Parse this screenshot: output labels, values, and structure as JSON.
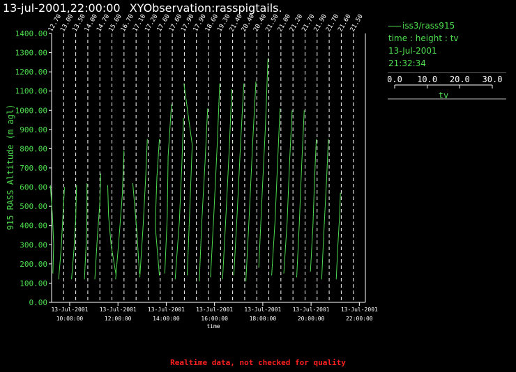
{
  "header": {
    "timestamp": "13-jul-2001,22:00:00",
    "title": "XYObservation:rasspigtails."
  },
  "legend": {
    "series_name": "iss3/rass915",
    "line2": "time : height : tv",
    "line3": "13-Jul-2001",
    "line4": "21:32:34",
    "scale_ticks": [
      "0.0",
      "10.0",
      "20.0",
      "30.0"
    ],
    "scale_label": "tv"
  },
  "footer": {
    "note": "Realtime data, not checked for quality"
  },
  "colors": {
    "trace": "#4ddc4d",
    "axis": "#ffffff",
    "title_text": "#ffffff",
    "warning": "#ff2020",
    "background": "#000000"
  },
  "chart_data": {
    "type": "line",
    "title": "XYObservation:rasspigtails.",
    "xlabel": "time",
    "ylabel": "915 RASS Altitude (m agl)",
    "ylim": [
      0,
      1400
    ],
    "xlim_hours": [
      9.25,
      22.25
    ],
    "y_ticks": [
      "0.00",
      "100.00",
      "200.00",
      "300.00",
      "400.00",
      "500.00",
      "600.00",
      "700.00",
      "800.00",
      "900.00",
      "1000.00",
      "1100.00",
      "1200.00",
      "1300.00",
      "1400.00"
    ],
    "x_ticks": [
      {
        "hour": 10,
        "date": "13-Jul-2001",
        "time": "10:00:00"
      },
      {
        "hour": 12,
        "date": "13-Jul-2001",
        "time": "12:00:00"
      },
      {
        "hour": 14,
        "date": "13-Jul-2001",
        "time": "14:00:00"
      },
      {
        "hour": 16,
        "date": "13-Jul-2001",
        "time": "16:00:00"
      },
      {
        "hour": 18,
        "date": "13-Jul-2001",
        "time": "18:00:00"
      },
      {
        "hour": 20,
        "date": "13-Jul-2001",
        "time": "20:00:00"
      },
      {
        "hour": 22,
        "date": "13-Jul-2001",
        "time": "22:00:00"
      }
    ],
    "profiles": [
      {
        "hour": 9.25,
        "label": "12.70",
        "top": 610,
        "heights": [
          150,
          300,
          450,
          610
        ],
        "offsets": [
          1.5,
          2.5,
          1.0,
          -1.5
        ]
      },
      {
        "hour": 9.75,
        "label": "13.00",
        "top": 600,
        "heights": [
          120,
          280,
          440,
          600
        ],
        "offsets": [
          -6,
          -3,
          -1,
          1
        ]
      },
      {
        "hour": 10.25,
        "label": "13.50",
        "top": 610,
        "heights": [
          120,
          280,
          440,
          610
        ],
        "offsets": [
          -5,
          -2,
          0,
          1
        ]
      },
      {
        "hour": 10.75,
        "label": "14.00",
        "top": 620,
        "heights": [
          120,
          300,
          460,
          620
        ],
        "offsets": [
          -4,
          -2,
          -1,
          -1
        ]
      },
      {
        "hour": 11.25,
        "label": "14.70",
        "top": 670,
        "heights": [
          120,
          340,
          520,
          670
        ],
        "offsets": [
          -6,
          -3,
          0,
          1
        ]
      },
      {
        "hour": 11.75,
        "label": "15.60",
        "top": 610,
        "heights": [
          140,
          300,
          450,
          610
        ],
        "offsets": [
          5,
          -1,
          -4,
          -5
        ]
      },
      {
        "hour": 12.25,
        "label": "16.70",
        "top": 790,
        "heights": [
          120,
          330,
          560,
          790
        ],
        "offsets": [
          -10,
          -6,
          -2,
          0
        ]
      },
      {
        "hour": 12.75,
        "label": "17.10",
        "top": 620,
        "heights": [
          150,
          360,
          520,
          620
        ],
        "offsets": [
          4,
          1,
          -2,
          -4
        ]
      },
      {
        "hour": 13.25,
        "label": "17.20",
        "top": 850,
        "heights": [
          130,
          400,
          650,
          850
        ],
        "offsets": [
          -10,
          -6,
          -3,
          -1
        ]
      },
      {
        "hour": 13.75,
        "label": "17.60",
        "top": 850,
        "heights": [
          140,
          400,
          650,
          850
        ],
        "offsets": [
          -1,
          -6,
          -4,
          -1
        ]
      },
      {
        "hour": 14.25,
        "label": "17.60",
        "top": 1030,
        "heights": [
          150,
          450,
          760,
          1030
        ],
        "offsets": [
          -9,
          -6,
          -5,
          -1
        ]
      },
      {
        "hour": 14.75,
        "label": "17.90",
        "top": 960,
        "heights": [
          120,
          420,
          720,
          960
        ],
        "offsets": [
          -11,
          -6,
          -3,
          -1
        ]
      },
      {
        "hour": 15.25,
        "label": "17.90",
        "top": 1140,
        "heights": [
          140,
          480,
          820,
          1140
        ],
        "offsets": [
          -11,
          -8,
          -5,
          -15
        ]
      },
      {
        "hour": 15.75,
        "label": "18.60",
        "top": 1010,
        "heights": [
          110,
          420,
          740,
          1010
        ],
        "offsets": [
          -11,
          -8,
          -4,
          -1
        ]
      },
      {
        "hour": 16.25,
        "label": "19.30",
        "top": 1140,
        "heights": [
          130,
          460,
          820,
          1140
        ],
        "offsets": [
          -12,
          -8,
          -4,
          -1
        ]
      },
      {
        "hour": 16.75,
        "label": "21.40",
        "top": 1110,
        "heights": [
          120,
          450,
          800,
          1110
        ],
        "offsets": [
          -12,
          -8,
          -4,
          -1
        ]
      },
      {
        "hour": 17.25,
        "label": "20.40",
        "top": 1140,
        "heights": [
          140,
          460,
          820,
          1140
        ],
        "offsets": [
          -13,
          -9,
          -5,
          -1
        ]
      },
      {
        "hour": 17.75,
        "label": "20.40",
        "top": 1150,
        "heights": [
          110,
          450,
          820,
          1150
        ],
        "offsets": [
          -13,
          -9,
          -5,
          -1
        ]
      },
      {
        "hour": 18.25,
        "label": "21.50",
        "top": 1270,
        "heights": [
          180,
          560,
          920,
          1270
        ],
        "offsets": [
          -12,
          -8,
          -4,
          -1
        ]
      },
      {
        "hour": 18.75,
        "label": "21.00",
        "top": 1010,
        "heights": [
          140,
          420,
          720,
          1010
        ],
        "offsets": [
          -11,
          -7,
          -4,
          -1
        ]
      },
      {
        "hour": 19.25,
        "label": "21.20",
        "top": 1000,
        "heights": [
          150,
          420,
          740,
          1000
        ],
        "offsets": [
          -11,
          -7,
          -4,
          -1
        ]
      },
      {
        "hour": 19.75,
        "label": "21.70",
        "top": 1000,
        "heights": [
          130,
          400,
          720,
          1000
        ],
        "offsets": [
          -10,
          -7,
          -4,
          -1
        ]
      },
      {
        "hour": 20.25,
        "label": "21.90",
        "top": 850,
        "heights": [
          160,
          400,
          650,
          850
        ],
        "offsets": [
          -8,
          -5,
          -3,
          -1
        ]
      },
      {
        "hour": 20.75,
        "label": "21.70",
        "top": 850,
        "heights": [
          120,
          400,
          650,
          850
        ],
        "offsets": [
          -9,
          -6,
          -3,
          -1
        ]
      },
      {
        "hour": 21.25,
        "label": "21.60",
        "top": 570,
        "heights": [
          120,
          300,
          450,
          570
        ],
        "offsets": [
          -6,
          -4,
          -2,
          -1
        ]
      },
      {
        "hour": 21.75,
        "label": "21.50",
        "top": 0,
        "heights": [],
        "offsets": []
      }
    ]
  }
}
